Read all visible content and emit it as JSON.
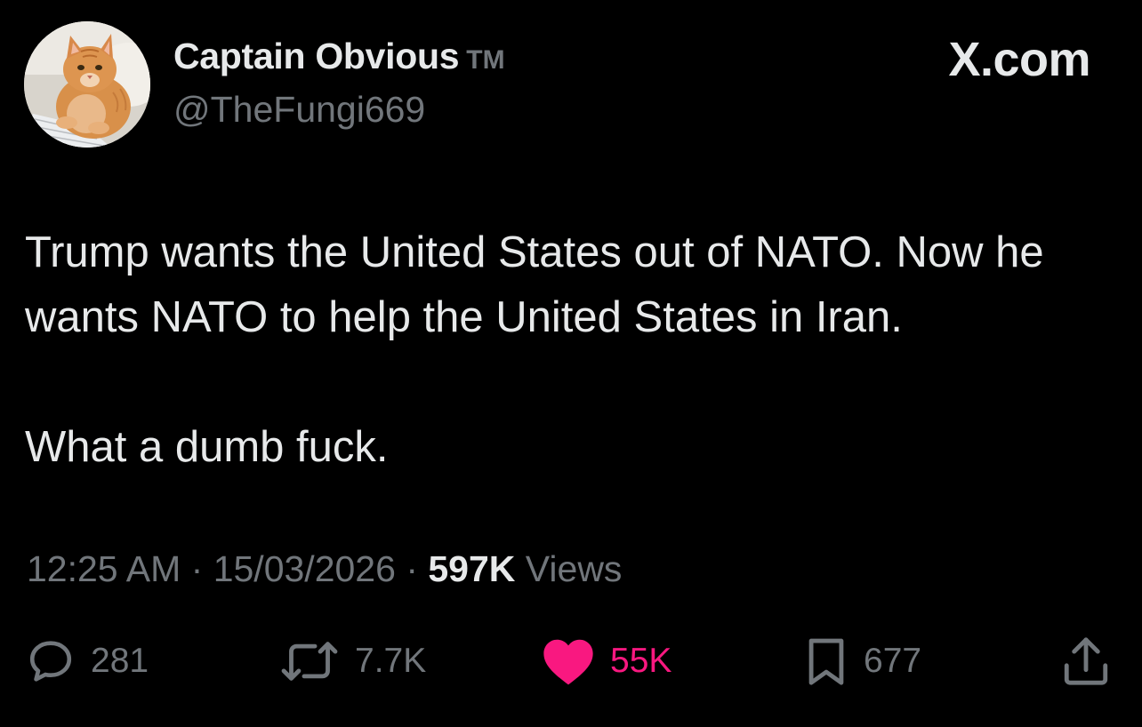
{
  "author": {
    "display_name": "Captain Obvious",
    "badge": "TM",
    "handle": "@TheFungi669",
    "avatar": "orange-cat-at-keyboard"
  },
  "brand": "X.com",
  "tweet": {
    "paragraphs": [
      "Trump wants the United States out of NATO. Now he wants NATO to help the United States in Iran.",
      "What a dumb fuck."
    ]
  },
  "meta": {
    "time": "12:25 AM",
    "separator": "·",
    "date": "15/03/2026",
    "views_count": "597K",
    "views_label": "Views"
  },
  "actions": {
    "reply": {
      "icon": "reply-icon",
      "count": "281"
    },
    "repost": {
      "icon": "repost-icon",
      "count": "7.7K"
    },
    "like": {
      "icon": "heart-icon",
      "count": "55K",
      "color": "#f91880"
    },
    "bookmark": {
      "icon": "bookmark-icon",
      "count": "677"
    },
    "share": {
      "icon": "share-icon"
    }
  },
  "colors": {
    "background": "#000000",
    "primary_text": "#e7e9ea",
    "secondary_text": "#71767b",
    "like_active": "#f91880"
  }
}
